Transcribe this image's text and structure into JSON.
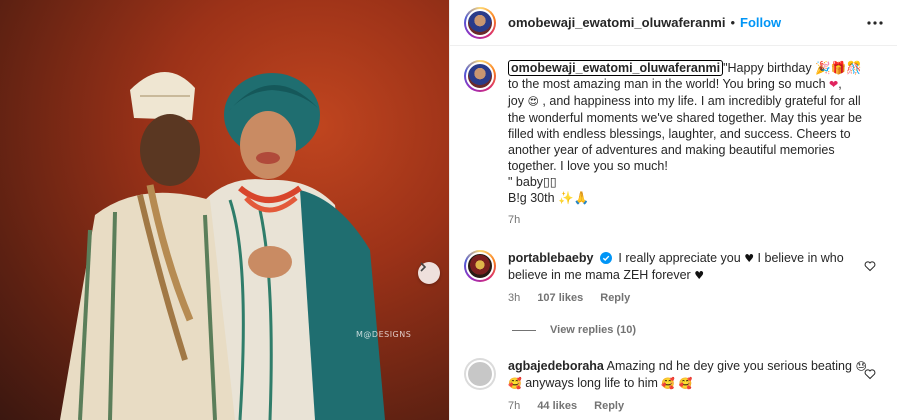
{
  "post": {
    "author": "omobewaji_ewatomi_oluwaferanmi",
    "separator": "•",
    "follow_label": "Follow",
    "photo": {
      "watermark": "M@DESIGNS"
    },
    "caption": {
      "username": "omobewaji_ewatomi_oluwaferanmi",
      "line1": "\"Happy birthday 🎉🎁🎊",
      "line2": "to the most amazing man in the world! You bring so much",
      "line2_tail": ",",
      "line3_a": "joy",
      "line3_b": ", and happiness into my life. I am incredibly grateful for all the wonderful moments we've shared together. May this year be filled with endless blessings, laughter, and success. Cheers to another year of adventures and making beautiful memories together. I love you so much!",
      "line4": "\" baby▯▯",
      "line5": "B!g 30th ✨🙏",
      "time": "7h"
    }
  },
  "comments": [
    {
      "username": "portablebaeby",
      "verified": true,
      "text_a": "I really appreciate you",
      "text_b": "I believe in who believe in me mama ZEH forever",
      "time": "3h",
      "likes": "107 likes",
      "reply_label": "Reply",
      "view_replies": "View replies (10)"
    },
    {
      "username": "agbajedeboraha",
      "text": "Amazing nd he dey give you serious beating",
      "text_tail": "anyways long life to him",
      "time": "7h",
      "likes": "44 likes",
      "reply_label": "Reply"
    }
  ],
  "icons": {
    "more": "more-horizontal-icon",
    "like": "heart-outline-icon",
    "next": "chevron-right-icon",
    "verified": "verified-badge-icon"
  },
  "colors": {
    "follow": "#0095f6",
    "verified": "#0095f6",
    "heart": "#e0245e"
  }
}
